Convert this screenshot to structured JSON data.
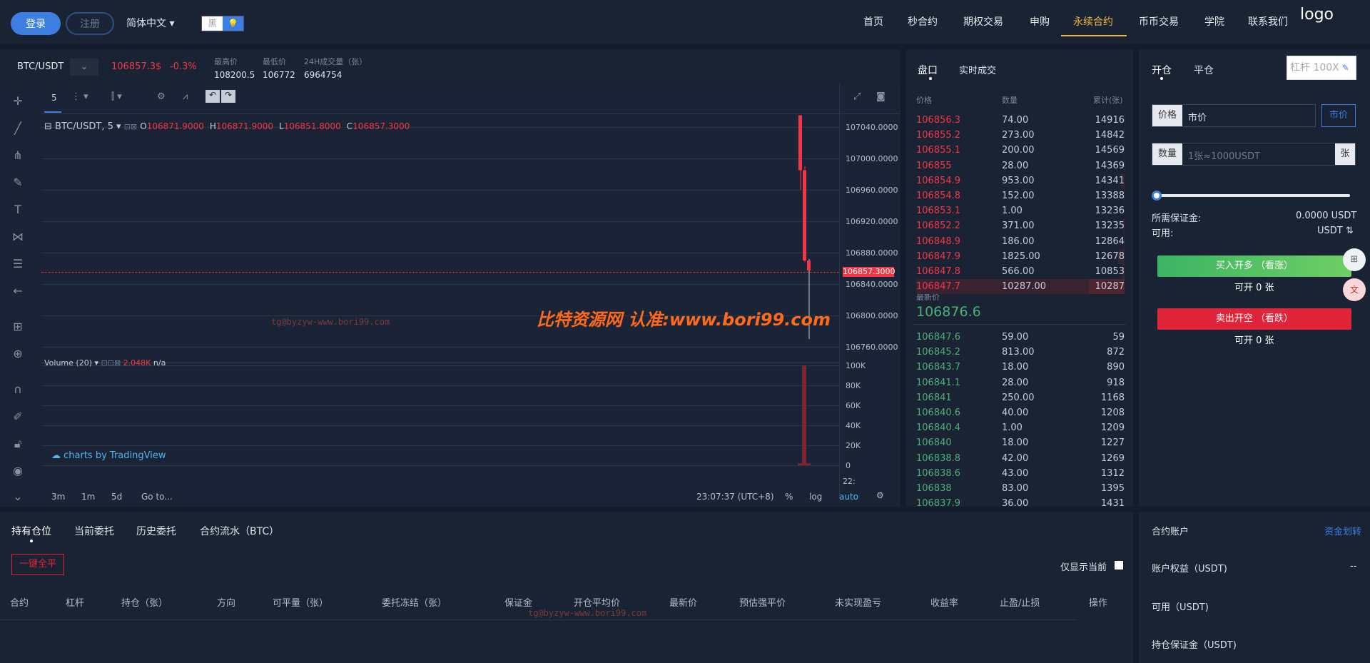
{
  "header": {
    "login": "登录",
    "register": "注册",
    "language": "简体中文 ▾",
    "theme_light": "黑",
    "theme_dark": "💡",
    "logo": "logo",
    "nav": [
      "首页",
      "秒合约",
      "期权交易",
      "申购",
      "永续合约",
      "币币交易",
      "学院",
      "联系我们"
    ]
  },
  "ticker": {
    "pair": "BTC/USDT",
    "price": "106857.3$",
    "change": "-0.3%",
    "high_label": "最高价",
    "high": "108200.5",
    "low_label": "最低价",
    "low": "106772",
    "vol_label": "24H成交量（张）",
    "vol": "6964754"
  },
  "chart": {
    "interval": "5",
    "legend_pair": "BTC/USDT, 5 ▾",
    "o": "106871.9000",
    "h": "106871.9000",
    "l": "106851.8000",
    "c": "106857.3000",
    "volume_label": "Volume (20) ▾",
    "volume_value": "2.048K",
    "volume_na": "n/a",
    "brand": "charts by TradingView",
    "watermark": "比特资源网 认准:www.bori99.com",
    "watermark2": "tg@byzyw-www.bori99.com",
    "price_tag": "106857.3000",
    "time_label": "22:",
    "yticks": [
      "107040.0000",
      "107000.0000",
      "106960.0000",
      "106920.0000",
      "106880.0000",
      "106840.0000",
      "106800.0000",
      "106760.0000"
    ],
    "vticks": [
      "100K",
      "80K",
      "60K",
      "40K",
      "20K",
      "0"
    ],
    "ranges": [
      "3m",
      "1m",
      "5d",
      "Go to..."
    ],
    "clock": "23:07:37 (UTC+8)",
    "pct": "%",
    "log": "log",
    "auto": "auto"
  },
  "chart_data": {
    "type": "candlestick",
    "title": "BTC/USDT, 5",
    "series": [
      {
        "name": "price",
        "ohlc": [
          [
            107055,
            107055,
            106960,
            106985
          ],
          [
            106985,
            106990,
            106868,
            106870
          ],
          [
            106870,
            106872,
            106770,
            106857.3
          ]
        ]
      },
      {
        "name": "Volume",
        "values": [
          2048,
          100000,
          2048
        ]
      }
    ]
  },
  "book": {
    "tab1": "盘口",
    "tab2": "实时成交",
    "h_price": "价格",
    "h_qty": "数量",
    "h_total": "累计(张)",
    "asks": [
      [
        "106856.3",
        "74.00",
        "14916"
      ],
      [
        "106855.2",
        "273.00",
        "14842"
      ],
      [
        "106855.1",
        "200.00",
        "14569"
      ],
      [
        "106855",
        "28.00",
        "14369"
      ],
      [
        "106854.9",
        "953.00",
        "14341"
      ],
      [
        "106854.8",
        "152.00",
        "13388"
      ],
      [
        "106853.1",
        "1.00",
        "13236"
      ],
      [
        "106852.2",
        "371.00",
        "13235"
      ],
      [
        "106848.9",
        "186.00",
        "12864"
      ],
      [
        "106847.9",
        "1825.00",
        "12678"
      ],
      [
        "106847.8",
        "566.00",
        "10853"
      ],
      [
        "106847.7",
        "10287.00",
        "10287"
      ]
    ],
    "last_label": "最新价",
    "last": "106876.6",
    "bids": [
      [
        "106847.6",
        "59.00",
        "59"
      ],
      [
        "106845.2",
        "813.00",
        "872"
      ],
      [
        "106843.7",
        "18.00",
        "890"
      ],
      [
        "106841.1",
        "28.00",
        "918"
      ],
      [
        "106841",
        "250.00",
        "1168"
      ],
      [
        "106840.6",
        "40.00",
        "1208"
      ],
      [
        "106840.4",
        "1.00",
        "1209"
      ],
      [
        "106840",
        "18.00",
        "1227"
      ],
      [
        "106838.8",
        "42.00",
        "1269"
      ],
      [
        "106838.6",
        "43.00",
        "1312"
      ],
      [
        "106838",
        "83.00",
        "1395"
      ],
      [
        "106837.9",
        "36.00",
        "1431"
      ]
    ]
  },
  "trade": {
    "tab_open": "开仓",
    "tab_close": "平仓",
    "leverage": "杠杆 100X",
    "price_label": "价格",
    "price_value": "市价",
    "market_btn": "市价",
    "qty_label": "数量",
    "qty_ph": "1张≈1000USDT",
    "qty_unit": "张",
    "margin_label": "所需保证金:",
    "margin": "0.0000 USDT",
    "avail_label": "可用:",
    "avail": "USDT ⇅",
    "buy": "买入开多 （看涨）",
    "buy_sub": "可开 0 张",
    "sell": "卖出开空 （看跌）",
    "sell_sub": "可开 0 张"
  },
  "positions": {
    "tabs": [
      "持有仓位",
      "当前委托",
      "历史委托",
      "合约流水（BTC）"
    ],
    "close_all": "一键全平",
    "only_current": "仅显示当前",
    "cols": [
      "合约",
      "杠杆",
      "持仓（张）",
      "方向",
      "可平量（张）",
      "委托冻结（张）",
      "保证金",
      "开仓平均价",
      "最新价",
      "预估强平价",
      "未实现盈亏",
      "收益率",
      "止盈/止损",
      "操作"
    ]
  },
  "account": {
    "title": "合约账户",
    "transfer": "资金划转",
    "equity": "账户权益（USDT)",
    "equity_val": "--",
    "avail": "可用（USDT)",
    "margin": "持仓保证金（USDT)"
  }
}
